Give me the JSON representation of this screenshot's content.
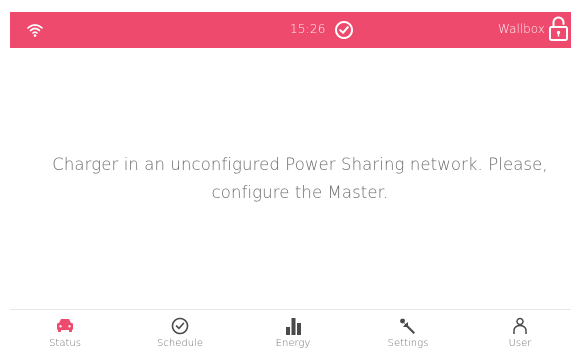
{
  "topbar": {
    "time": "15:26",
    "brand": "Wallbox"
  },
  "message": {
    "line1": "Charger in an unconfigured Power Sharing network. Please,",
    "line2": "configure the Master."
  },
  "nav": {
    "items": [
      {
        "label": "Status",
        "icon": "car-icon",
        "active": true
      },
      {
        "label": "Schedule",
        "icon": "clock-icon",
        "active": false
      },
      {
        "label": "Energy",
        "icon": "bar-chart-icon",
        "active": false
      },
      {
        "label": "Settings",
        "icon": "wrench-icon",
        "active": false
      },
      {
        "label": "User",
        "icon": "user-icon",
        "active": false
      }
    ]
  },
  "colors": {
    "accent": "#ee4a6d",
    "text": "#6b6b6b",
    "icon": "#4a4a4a"
  }
}
